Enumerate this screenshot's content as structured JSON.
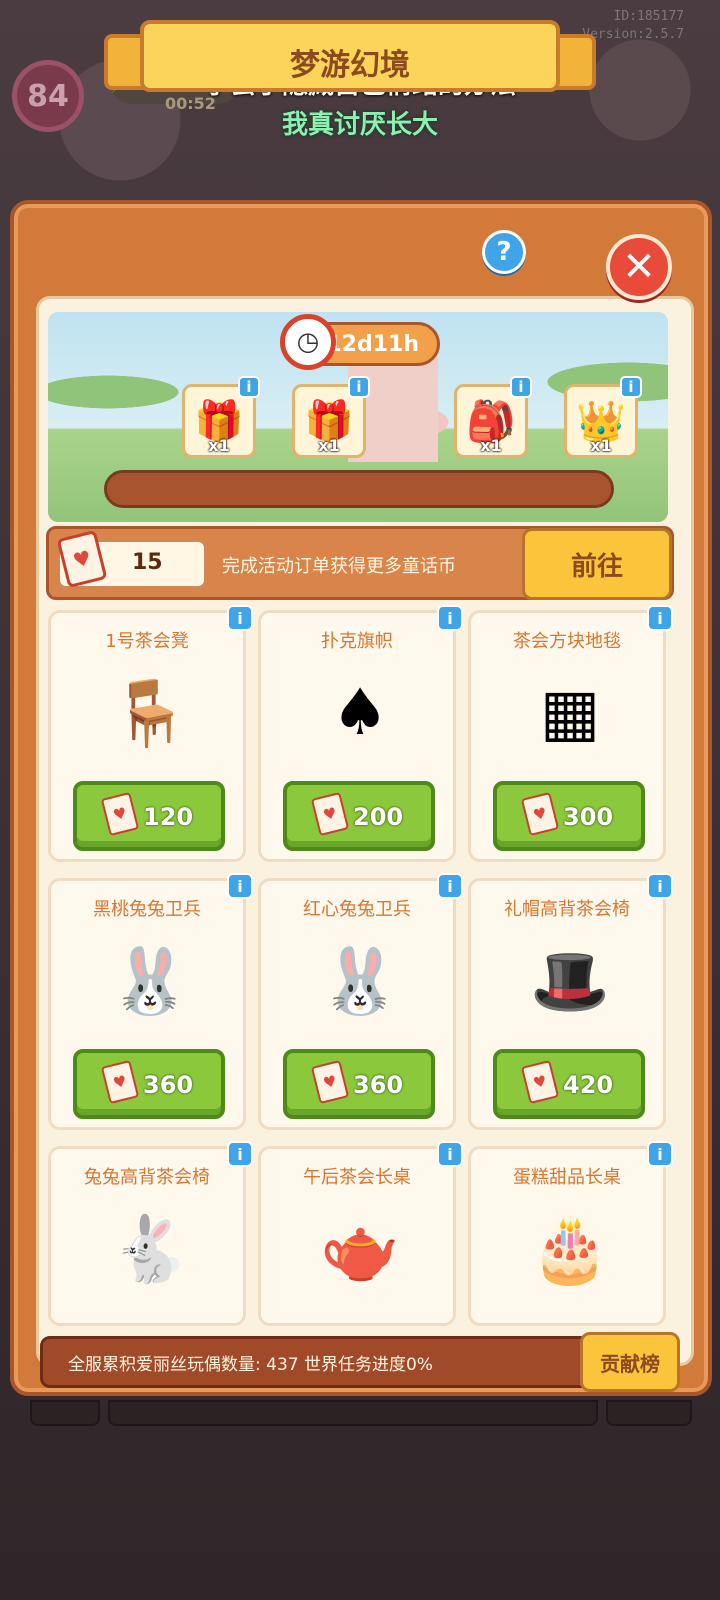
{
  "hud": {
    "level": "84",
    "energy_timer": "00:52",
    "id_text": "ID:185177",
    "version_text": "Version:2.5.7"
  },
  "subtitles": {
    "line1": "学会了隐藏自己情绪的办法",
    "line2": "我真讨厌长大"
  },
  "panel": {
    "title": "梦游幻境",
    "help_label": "?",
    "close_label": "✕"
  },
  "event": {
    "time_left": "12d11h",
    "rewards": [
      {
        "icon": "gift-box-red",
        "count": "x1"
      },
      {
        "icon": "gift-box-yellow",
        "count": "x1"
      },
      {
        "icon": "pink-backpack",
        "count": "x1"
      },
      {
        "icon": "queen-crown-hat",
        "count": "x1"
      }
    ],
    "progress": 0
  },
  "currency": {
    "amount": "15",
    "hint": "完成活动订单获得更多童话币",
    "goto_label": "前往"
  },
  "shop": {
    "items": [
      {
        "name": "1号茶会凳",
        "price": "120",
        "icon": "heart-stool"
      },
      {
        "name": "扑克旗帜",
        "price": "200",
        "icon": "poker-banner"
      },
      {
        "name": "茶会方块地毯",
        "price": "300",
        "icon": "checker-rug"
      },
      {
        "name": "黑桃兔兔卫兵",
        "price": "360",
        "icon": "spade-bunny-guard"
      },
      {
        "name": "红心兔兔卫兵",
        "price": "360",
        "icon": "heart-bunny-guard"
      },
      {
        "name": "礼帽高背茶会椅",
        "price": "420",
        "icon": "tophat-chair"
      },
      {
        "name": "兔兔高背茶会椅",
        "price": "",
        "icon": "bunny-chair"
      },
      {
        "name": "午后茶会长桌",
        "price": "",
        "icon": "tea-table"
      },
      {
        "name": "蛋糕甜品长桌",
        "price": "",
        "icon": "cake-table"
      }
    ],
    "info_label": "i"
  },
  "footer": {
    "stats_text": "全服累积爱丽丝玩偶数量: 437 世界任务进度0%",
    "rank_label": "贡献榜"
  },
  "colors": {
    "panel_orange": "#d27a3a",
    "price_green": "#8cc83c",
    "info_blue": "#3fa4e8",
    "close_red": "#e84b3a",
    "title_text": "#8c4a1e"
  }
}
